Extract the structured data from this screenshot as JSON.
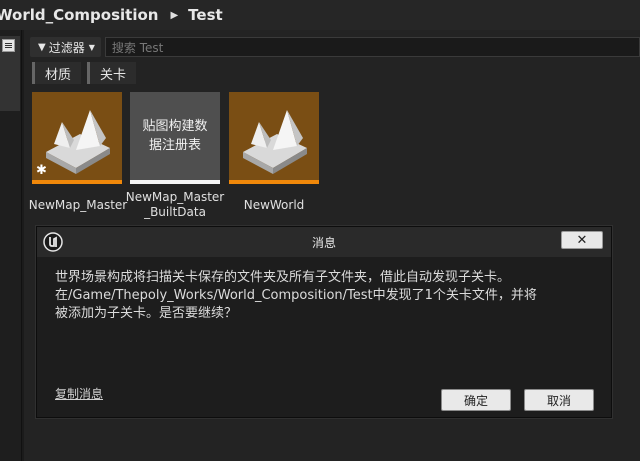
{
  "breadcrumb": {
    "items": [
      "World_Composition",
      "Test"
    ],
    "separator": "▶"
  },
  "toolbar": {
    "filter_label": "过滤器",
    "search_placeholder": "搜索 Test"
  },
  "filter_chips": [
    "材质",
    "关卡"
  ],
  "assets": [
    {
      "name": "NewMap_Master",
      "type": "level"
    },
    {
      "name": "NewMap_Master_BuiltData",
      "name_line1": "NewMap_Master",
      "name_line2": "_BuiltData",
      "thumb_text_line1": "贴图构建数",
      "thumb_text_line2": "据注册表",
      "type": "data"
    },
    {
      "name": "NewWorld",
      "type": "level"
    }
  ],
  "dialog": {
    "title": "消息",
    "close_label": "✕",
    "message_line1": "世界场景构成将扫描关卡保存的文件夹及所有子文件夹，借此自动发现子关卡。",
    "message_line2": "在/Game/Thepoly_Works/World_Composition/Test中发现了1个关卡文件，并将",
    "message_line3": "被添加为子关卡。是否要继续？",
    "copy_label": "复制消息",
    "ok_label": "确定",
    "cancel_label": "取消"
  },
  "colors": {
    "level_thumb": "#7a4e14",
    "level_bar": "#f0880a",
    "data_thumb": "#4f4f4f"
  }
}
